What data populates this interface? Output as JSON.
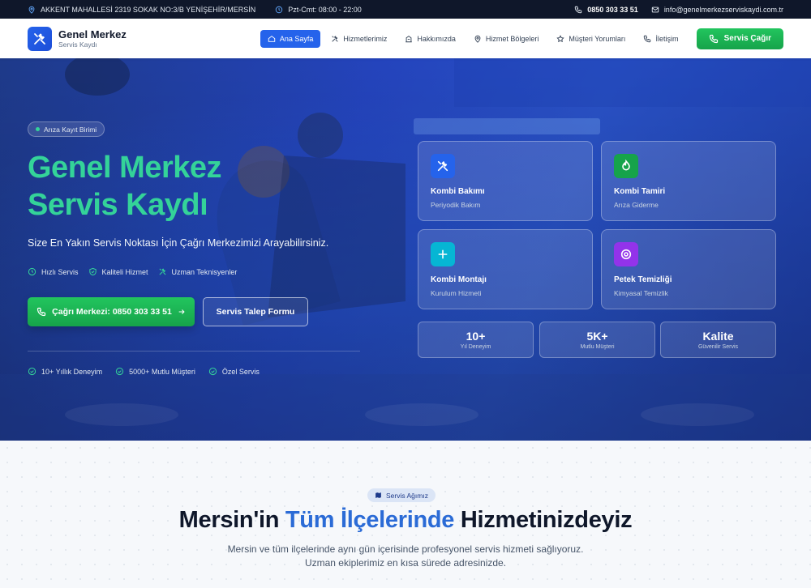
{
  "topbar": {
    "address": "AKKENT MAHALLESİ 2319 SOKAK NO:3/B YENİŞEHİR/MERSİN",
    "hours": "Pzt-Cmt: 08:00 - 22:00",
    "phone": "0850 303 33 51",
    "email": "info@genelmerkezserviskaydi.com.tr"
  },
  "header": {
    "logo_title": "Genel Merkez",
    "logo_subtitle": "Servis Kaydı",
    "nav": [
      {
        "label": "Ana Sayfa",
        "icon": "home-icon",
        "active": true
      },
      {
        "label": "Hizmetlerimiz",
        "icon": "tools-icon"
      },
      {
        "label": "Hakkımızda",
        "icon": "building-icon"
      },
      {
        "label": "Hizmet Bölgeleri",
        "icon": "map-pin-icon"
      },
      {
        "label": "Müşteri Yorumları",
        "icon": "star-icon"
      },
      {
        "label": "İletişim",
        "icon": "phone-icon"
      }
    ],
    "cta": "Servis Çağır"
  },
  "hero": {
    "badge": "Arıza Kayıt Birimi",
    "title_line1": "Genel Merkez",
    "title_line2": "Servis Kaydı",
    "subtitle": "Size En Yakın Servis Noktası İçin Çağrı Merkezimizi Arayabilirsiniz.",
    "features": [
      "Hızlı Servis",
      "Kaliteli Hizmet",
      "Uzman Teknisyenler"
    ],
    "call_button": "Çağrı Merkezi: 0850 303 33 51",
    "form_button": "Servis Talep Formu",
    "trust": [
      "10+ Yıllık Deneyim",
      "5000+ Mutlu Müşteri",
      "Özel Servis"
    ],
    "cards": [
      {
        "title": "Kombi Bakımı",
        "subtitle": "Periyodik Bakım",
        "color": "#2563eb",
        "icon": "tools-icon"
      },
      {
        "title": "Kombi Tamiri",
        "subtitle": "Arıza Giderme",
        "color": "#16a34a",
        "icon": "flame-icon"
      },
      {
        "title": "Kombi Montajı",
        "subtitle": "Kurulum Hizmeti",
        "color": "#06b6d4",
        "icon": "plus-icon"
      },
      {
        "title": "Petek Temizliği",
        "subtitle": "Kimyasal Temizlik",
        "color": "#9333ea",
        "icon": "target-icon"
      }
    ],
    "stats": [
      {
        "value": "10+",
        "label": "Yıl Deneyim"
      },
      {
        "value": "5K+",
        "label": "Mutlu Müşteri"
      },
      {
        "value": "Kalite",
        "label": "Güvenilir Servis"
      }
    ]
  },
  "section": {
    "badge": "Servis Ağımız",
    "title_pre": "Mersin'in",
    "title_highlight": "Tüm İlçelerinde",
    "title_post": "Hizmetinizdeyiz",
    "desc_line1": "Mersin ve tüm ilçelerinde aynı gün içerisinde profesyonel servis hizmeti sağlıyoruz.",
    "desc_line2": "Uzman ekiplerimiz en kısa sürede adresinizde."
  }
}
